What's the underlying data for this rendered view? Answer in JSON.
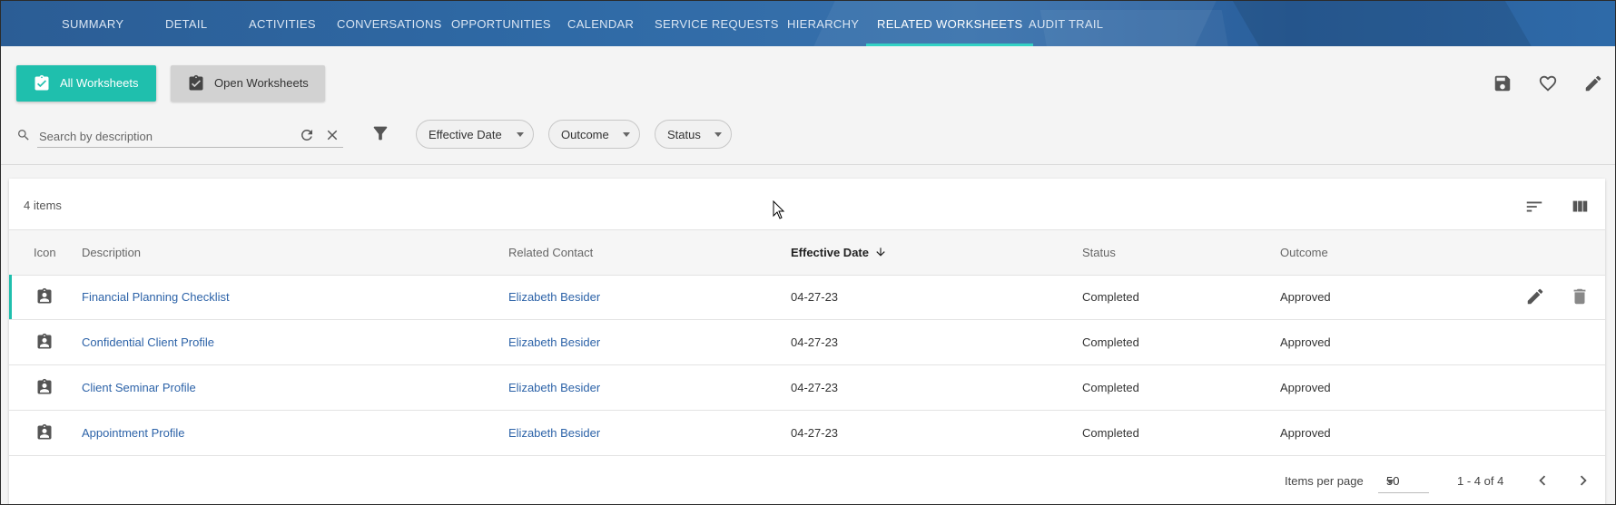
{
  "nav": {
    "tabs": [
      {
        "label": "SUMMARY"
      },
      {
        "label": "DETAIL"
      },
      {
        "label": "ACTIVITIES"
      },
      {
        "label": "CONVERSATIONS"
      },
      {
        "label": "OPPORTUNITIES"
      },
      {
        "label": "CALENDAR"
      },
      {
        "label": "SERVICE REQUESTS"
      },
      {
        "label": "HIERARCHY"
      },
      {
        "label": "RELATED WORKSHEETS",
        "active": true
      },
      {
        "label": "AUDIT TRAIL"
      }
    ]
  },
  "toolbar": {
    "all_worksheets": "All Worksheets",
    "open_worksheets": "Open Worksheets",
    "icons": [
      "save-icon",
      "heart-icon",
      "edit-icon"
    ]
  },
  "filters": {
    "search_placeholder": "Search by description",
    "search_value": "",
    "chips": [
      "Effective Date",
      "Outcome",
      "Status"
    ]
  },
  "table": {
    "count": "4 items",
    "columns": [
      "Icon",
      "Description",
      "Related Contact",
      "Effective Date",
      "Status",
      "Outcome"
    ],
    "sorted_column": "Effective Date",
    "rows": [
      {
        "description": "Financial Planning Checklist",
        "contact": "Elizabeth Besider",
        "date": "04-27-23",
        "status": "Completed",
        "outcome": "Approved",
        "selected": true
      },
      {
        "description": "Confidential Client Profile",
        "contact": "Elizabeth Besider",
        "date": "04-27-23",
        "status": "Completed",
        "outcome": "Approved"
      },
      {
        "description": "Client Seminar Profile",
        "contact": "Elizabeth Besider",
        "date": "04-27-23",
        "status": "Completed",
        "outcome": "Approved"
      },
      {
        "description": "Appointment Profile",
        "contact": "Elizabeth Besider",
        "date": "04-27-23",
        "status": "Completed",
        "outcome": "Approved"
      }
    ]
  },
  "pager": {
    "items_per_page_label": "Items per page",
    "items_per_page": "50",
    "range": "1 - 4 of 4"
  },
  "colors": {
    "accent": "#1fbfad",
    "nav_bg": "#2f6aa6",
    "link": "#2d63a8"
  }
}
